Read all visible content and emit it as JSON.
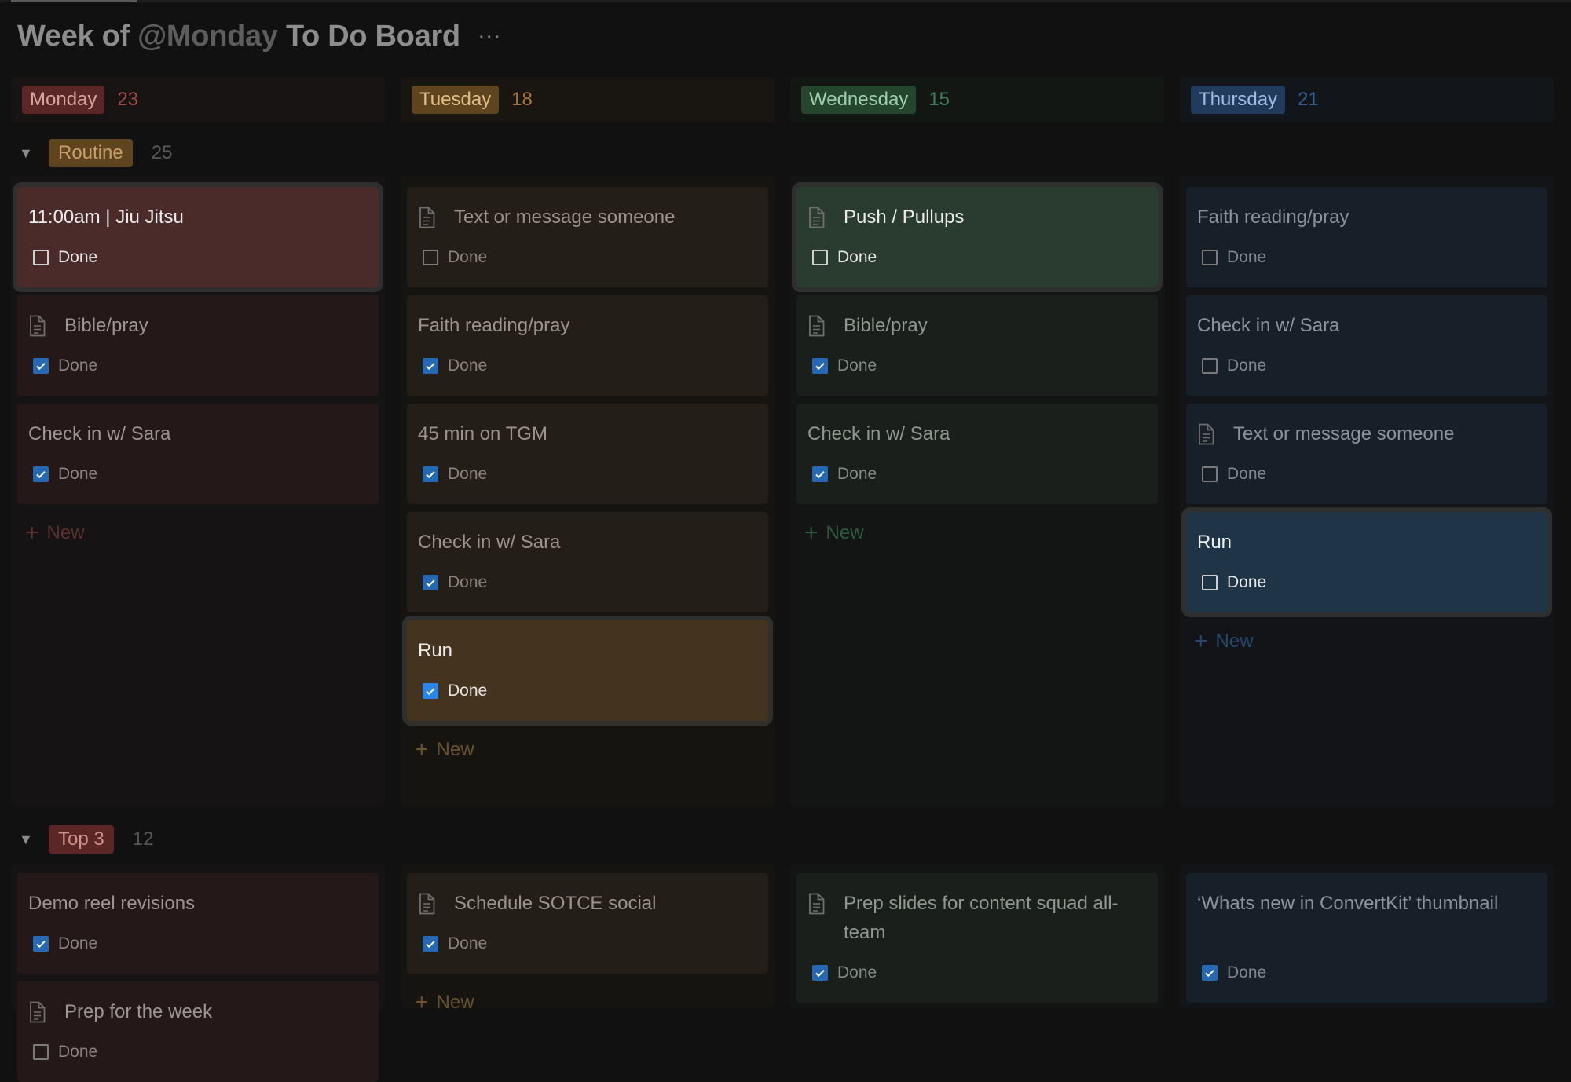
{
  "board": {
    "title_prefix": "Week of ",
    "title_mention": "@Monday",
    "title_suffix": " To Do Board",
    "more": "···"
  },
  "columns": [
    {
      "name": "Monday",
      "count": "23"
    },
    {
      "name": "Tuesday",
      "count": "18"
    },
    {
      "name": "Wednesday",
      "count": "15"
    },
    {
      "name": "Thursday",
      "count": "21"
    }
  ],
  "groups": [
    {
      "name": "Routine",
      "count": "25"
    },
    {
      "name": "Top 3",
      "count": "12"
    }
  ],
  "new_label": "New",
  "done_label": "Done",
  "routine": {
    "monday": [
      {
        "title": "11:00am | Jiu Jitsu",
        "done": false
      },
      {
        "title": "Bible/pray",
        "done": true
      },
      {
        "title": "Check in w/ Sara",
        "done": true
      }
    ],
    "tuesday": [
      {
        "title": "Text or message someone",
        "done": false
      },
      {
        "title": "Faith reading/pray",
        "done": true
      },
      {
        "title": "45 min on TGM",
        "done": true
      },
      {
        "title": "Check in w/ Sara",
        "done": true
      },
      {
        "title": "Run",
        "done": true
      }
    ],
    "wednesday": [
      {
        "title": "Push / Pullups",
        "done": false
      },
      {
        "title": "Bible/pray",
        "done": true
      },
      {
        "title": "Check in w/ Sara",
        "done": true
      }
    ],
    "thursday": [
      {
        "title": "Faith reading/pray",
        "done": false
      },
      {
        "title": "Check in w/ Sara",
        "done": false
      },
      {
        "title": "Text or message someone",
        "done": false
      },
      {
        "title": "Run",
        "done": false
      }
    ]
  },
  "top3": {
    "monday": [
      {
        "title": "Demo reel revisions",
        "done": true
      },
      {
        "title": "Prep for the week",
        "done": false
      }
    ],
    "tuesday": [
      {
        "title": "Schedule SOTCE social",
        "done": true
      }
    ],
    "wednesday": [
      {
        "title": "Prep slides for content squad all-team",
        "done": true
      }
    ],
    "thursday": [
      {
        "title": "‘Whats new in ConvertKit’ thumbnail",
        "done": true
      }
    ]
  },
  "colors": {
    "monday_accent": "#b9534f",
    "tuesday_accent": "#c58a3c",
    "wednesday_accent": "#4f9a72",
    "thursday_accent": "#4f80c0",
    "checkbox_blue": "#2a86e8"
  }
}
